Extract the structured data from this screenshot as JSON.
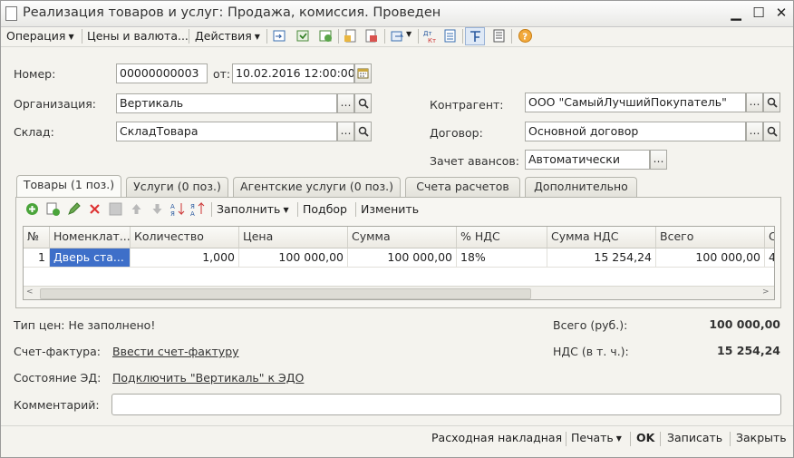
{
  "window": {
    "title": "Реализация товаров и услуг: Продажа, комиссия. Проведен",
    "minimize": "▁",
    "maximize": "☐",
    "close": "✕"
  },
  "toolbar": {
    "operation": "Операция",
    "prices": "Цены и валюта...",
    "actions": "Действия"
  },
  "header": {
    "number_label": "Номер:",
    "number_value": "00000000003",
    "date_label": "от:",
    "date_value": "10.02.2016 12:00:00",
    "org_label": "Организация:",
    "org_value": "Вертикаль",
    "warehouse_label": "Склад:",
    "warehouse_value": "СкладТовара",
    "contractor_label": "Контрагент:",
    "contractor_value": "ООО \"СамыйЛучшийПокупатель\"",
    "contract_label": "Договор:",
    "contract_value": "Основной договор",
    "advance_label": "Зачет авансов:",
    "advance_value": "Автоматически"
  },
  "tabs": [
    {
      "label": "Товары (1 поз.)"
    },
    {
      "label": "Услуги (0 поз.)"
    },
    {
      "label": "Агентские услуги (0 поз.)"
    },
    {
      "label": "Счета расчетов"
    },
    {
      "label": "Дополнительно"
    }
  ],
  "table_toolbar": {
    "fill": "Заполнить",
    "select": "Подбор",
    "change": "Изменить"
  },
  "table": {
    "columns": [
      "№",
      "Номенклат...",
      "Количество",
      "Цена",
      "Сумма",
      "% НДС",
      "Сумма НДС",
      "Всего",
      "С"
    ],
    "rows": [
      {
        "n": "1",
        "item": "Дверь ста...",
        "qty": "1,000",
        "price": "100 000,00",
        "sum": "100 000,00",
        "vat_rate": "18%",
        "vat_sum": "15 254,24",
        "total": "100 000,00",
        "extra": "4"
      }
    ]
  },
  "footer": {
    "price_type": "Тип цен: Не заполнено!",
    "total_label": "Всего (руб.):",
    "total_value": "100 000,00",
    "invoice_label": "Счет-фактура:",
    "invoice_link": "Ввести счет-фактуру",
    "vat_label": "НДС (в т. ч.):",
    "vat_value": "15 254,24",
    "edo_label": "Состояние ЭД:",
    "edo_link": "Подключить \"Вертикаль\" к ЭДО",
    "comment_label": "Комментарий:",
    "comment_value": ""
  },
  "bottom": {
    "waybill": "Расходная накладная",
    "print": "Печать",
    "ok": "OK",
    "save": "Записать",
    "close": "Закрыть"
  },
  "colors": {
    "accent": "#316ac5",
    "selected_cell": "#3e6fc9"
  }
}
